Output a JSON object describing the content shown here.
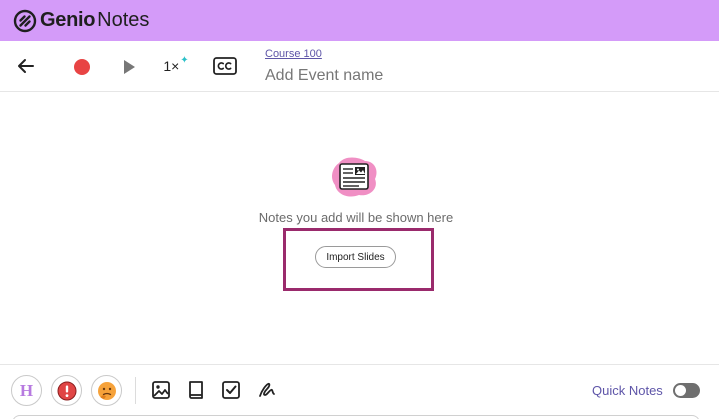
{
  "brand": {
    "name_bold": "Genio",
    "name_regular": "Notes"
  },
  "toolbar": {
    "speed_label": "1×",
    "course_link": "Course 100",
    "event_placeholder": "Add Event name",
    "event_value": ""
  },
  "main": {
    "empty_message": "Notes you add will be shown here",
    "import_button": "Import Slides"
  },
  "formatbar": {
    "heading_letter": "H",
    "quick_notes_label": "Quick Notes",
    "quick_notes_enabled": false
  },
  "colors": {
    "brand_bar": "#d49bf9",
    "record": "#e84444",
    "highlight_border": "#9a2a6c",
    "accent_text": "#5e55a8",
    "heading_accent": "#b77ae0",
    "important_red": "#e04545",
    "confused_orange": "#f6a23a"
  },
  "icons": [
    "genio-logo-icon",
    "back-arrow-icon",
    "record-icon",
    "play-icon",
    "sparkle-icon",
    "closed-captions-icon",
    "slides-placeholder-icon",
    "heading-icon",
    "important-icon",
    "confused-icon",
    "image-icon",
    "book-icon",
    "checkbox-icon",
    "draw-icon"
  ]
}
